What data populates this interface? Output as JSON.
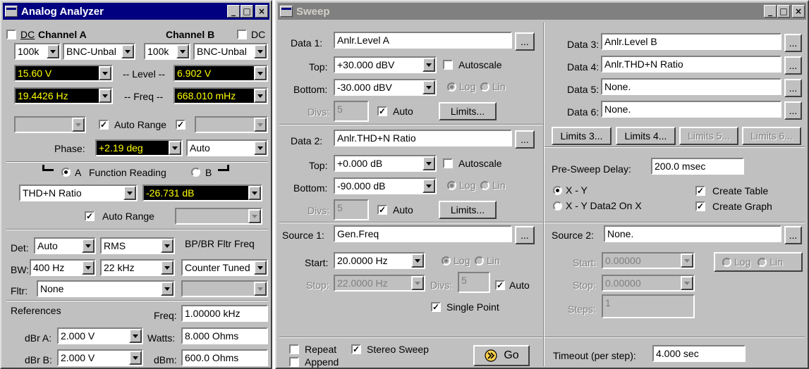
{
  "analyzer": {
    "title": "Analog Analyzer",
    "chA": {
      "dc_label": "DC",
      "title": "Channel A",
      "range": "100k",
      "input": "BNC-Unbal",
      "level": "15.60  V",
      "freq": "19.4426 Hz"
    },
    "chB": {
      "dc_label": "DC",
      "title": "Channel B",
      "range": "100k",
      "input": "BNC-Unbal",
      "level": "6.902  V",
      "freq": "668.010 mHz"
    },
    "level_label": "-- Level --",
    "freq_label": "-- Freq --",
    "auto_range_label": "Auto Range",
    "phase_label": "Phase:",
    "phase_value": "+2.19   deg",
    "phase_mode": "Auto",
    "func_a": "A",
    "func_label": "Function Reading",
    "func_b": "B",
    "func_select": "THD+N Ratio",
    "func_value": "-26.731  dB",
    "func_auto_range": "Auto Range",
    "det_label": "Det:",
    "det_value": "Auto",
    "det_mode": "RMS",
    "bpbr_label": "BP/BR Fltr Freq",
    "bw_label": "BW:",
    "bw_low": "400 Hz",
    "bw_high": "22 kHz",
    "bpbr_value": "Counter Tuned",
    "fltr_label": "Fltr:",
    "fltr_value": "None",
    "references_label": "References",
    "freq_ref_label": "Freq:",
    "freq_ref_value": "1.00000 kHz",
    "dbra_label": "dBr A:",
    "dbra_value": "2.000   V",
    "watts_label": "Watts:",
    "watts_value": "8.000    Ohms",
    "dbrb_label": "dBr B:",
    "dbrb_value": "2.000   V",
    "dbm_label": "dBm:",
    "dbm_value": "600.0    Ohms"
  },
  "sweep": {
    "title": "Sweep",
    "data1": {
      "label": "Data 1:",
      "value": "Anlr.Level A",
      "top_label": "Top:",
      "top": "+30.000  dBV",
      "bottom_label": "Bottom:",
      "bottom": "-30.000  dBV",
      "autoscale": "Autoscale",
      "divs_label": "Divs:",
      "divs": "5",
      "auto": "Auto",
      "limits": "Limits..."
    },
    "data2": {
      "label": "Data 2:",
      "value": "Anlr.THD+N Ratio",
      "top_label": "Top:",
      "top": "+0.000   dB",
      "bottom_label": "Bottom:",
      "bottom": "-90.000  dB",
      "autoscale": "Autoscale",
      "divs_label": "Divs:",
      "divs": "5",
      "auto": "Auto",
      "limits": "Limits..."
    },
    "log_label": "Log",
    "lin_label": "Lin",
    "data3": {
      "label": "Data 3:",
      "value": "Anlr.Level B"
    },
    "data4": {
      "label": "Data 4:",
      "value": "Anlr.THD+N Ratio"
    },
    "data5": {
      "label": "Data 5:",
      "value": "None."
    },
    "data6": {
      "label": "Data 6:",
      "value": "None."
    },
    "limits3": "Limits 3...",
    "limits4": "Limits 4...",
    "limits5": "Limits 5...",
    "limits6": "Limits 6...",
    "presweep_label": "Pre-Sweep Delay:",
    "presweep_value": "200.0    msec",
    "xy_label": "X - Y",
    "xy2_label": "X - Y  Data2 On X",
    "create_table": "Create Table",
    "create_graph": "Create Graph",
    "source1": {
      "label": "Source 1:",
      "value": "Gen.Freq",
      "start_label": "Start:",
      "start": "20.0000  Hz",
      "stop_label": "Stop:",
      "stop": "22.0000  Hz",
      "divs_label": "Divs:",
      "divs": "5",
      "auto": "Auto",
      "single_point": "Single Point"
    },
    "source2": {
      "label": "Source 2:",
      "value": "None.",
      "start_label": "Start:",
      "start": "0.00000",
      "stop_label": "Stop:",
      "stop": "0.00000",
      "steps_label": "Steps:",
      "steps": "1"
    },
    "repeat": "Repeat",
    "stereo": "Stereo Sweep",
    "append": "Append",
    "go": "Go",
    "timeout_label": "Timeout (per step):",
    "timeout_value": "4.000      sec",
    "dots": "..."
  },
  "window_buttons": {
    "minimize": "_",
    "maximize": "□",
    "close": "×"
  }
}
